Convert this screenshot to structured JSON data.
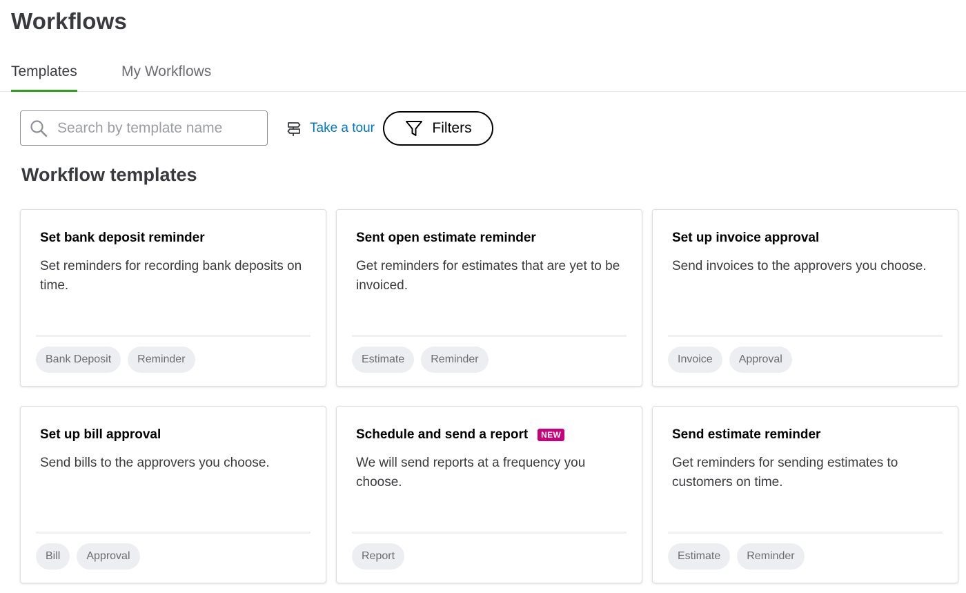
{
  "page": {
    "title": "Workflows"
  },
  "tabs": [
    {
      "label": "Templates",
      "active": true
    },
    {
      "label": "My Workflows",
      "active": false
    }
  ],
  "toolbar": {
    "search_placeholder": "Search by template name",
    "search_value": "",
    "tour_label": "Take a tour",
    "filters_label": "Filters"
  },
  "section": {
    "title": "Workflow templates"
  },
  "cards": [
    {
      "title": "Set bank deposit reminder",
      "badge": "",
      "description": "Set reminders for recording bank deposits on time.",
      "tags": [
        "Bank Deposit",
        "Reminder"
      ]
    },
    {
      "title": "Sent open estimate reminder",
      "badge": "",
      "description": "Get reminders for estimates that are yet to be invoiced.",
      "tags": [
        "Estimate",
        "Reminder"
      ]
    },
    {
      "title": "Set up invoice approval",
      "badge": "",
      "description": "Send invoices to the approvers you choose.",
      "tags": [
        "Invoice",
        "Approval"
      ]
    },
    {
      "title": "Set up bill approval",
      "badge": "",
      "description": "Send bills to the approvers you choose.",
      "tags": [
        "Bill",
        "Approval"
      ]
    },
    {
      "title": "Schedule and send a report",
      "badge": "NEW",
      "description": "We will send reports at a frequency you choose.",
      "tags": [
        "Report"
      ]
    },
    {
      "title": "Send estimate reminder",
      "badge": "",
      "description": "Get reminders for sending estimates to customers on time.",
      "tags": [
        "Estimate",
        "Reminder"
      ]
    }
  ],
  "colors": {
    "accent_tab": "#2ca01c",
    "link": "#0077c5",
    "new_badge": "#c9007a",
    "tag_bg": "#eceef1"
  },
  "icons": {
    "search": "search-icon",
    "tour": "signpost-icon",
    "filters": "funnel-icon"
  }
}
